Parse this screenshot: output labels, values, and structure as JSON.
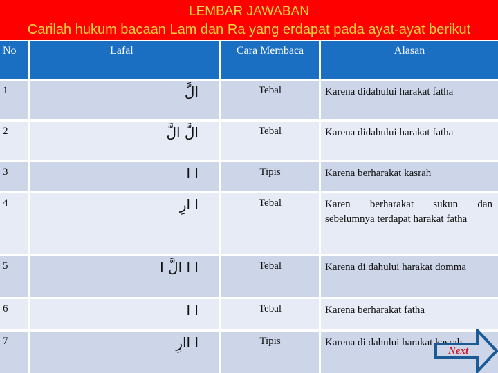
{
  "banner": {
    "title": "LEMBAR JAWABAN",
    "subtitle": "Carilah hukum bacaan Lam dan Ra yang erdapat pada ayat-ayat berikut"
  },
  "table": {
    "headers": {
      "no": "No",
      "lafal": "Lafal",
      "cara": "Cara Membaca",
      "alasan": "Alasan"
    },
    "rows": [
      {
        "no": "1",
        "lafal": "الَّ",
        "cara": "Tebal",
        "alasan": "Karena didahului harakat fatha"
      },
      {
        "no": "2",
        "lafal": "الَّ الَّ",
        "cara": "Tebal",
        "alasan": "Karena didahului harakat fatha"
      },
      {
        "no": "3",
        "lafal": "ا ا",
        "cara": "Tipis",
        "alasan": "Karena berharakat kasrah"
      },
      {
        "no": "4",
        "lafal": "ا ارِ",
        "cara": "Tebal",
        "alasan": "Karen berharakat sukun dan sebelumnya terdapat harakat fatha"
      },
      {
        "no": "5",
        "lafal": "ا ا  الَّ ا",
        "cara": "Tebal",
        "alasan": "Karena di dahului harakat domma"
      },
      {
        "no": "6",
        "lafal": "ا    ا",
        "cara": "Tebal",
        "alasan": "Karena berharakat fatha"
      },
      {
        "no": "7",
        "lafal": "ا    اارِ",
        "cara": "Tipis",
        "alasan": "Karena di dahului harakat kasrah"
      }
    ]
  },
  "navigation": {
    "next_label": "Next",
    "next_icon": "right-arrow-icon"
  },
  "colors": {
    "banner_bg": "#ff0000",
    "banner_text": "#f7d53c",
    "header_bg": "#1a6fc3",
    "row_dark": "#cdd6e9",
    "row_light": "#e7ebf5",
    "next_text": "#cc1a2a",
    "arrow_stroke": "#1b5a94"
  }
}
